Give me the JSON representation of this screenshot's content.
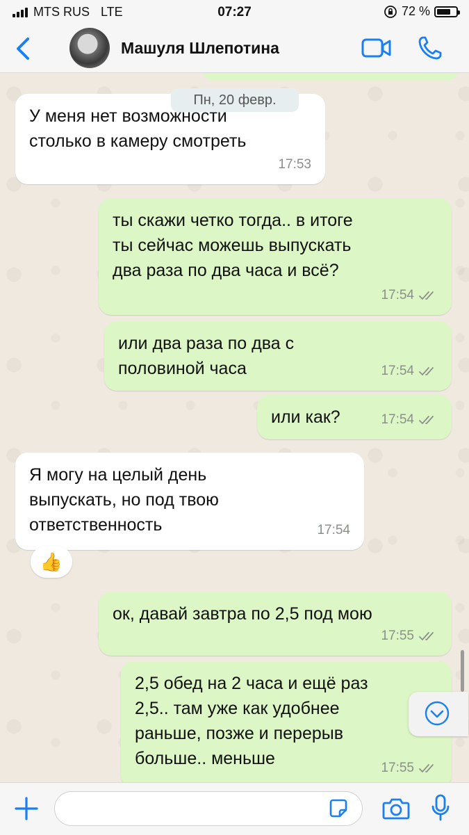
{
  "status_bar": {
    "carrier": "MTS RUS",
    "network": "LTE",
    "time": "07:27",
    "battery": "72 %",
    "battery_level": 0.72
  },
  "header": {
    "contact_name": "Машуля Шлепотина",
    "accent_color": "#1a7ff2"
  },
  "chat": {
    "date_chip": "Пн, 20 февр.",
    "messages": [
      {
        "direction": "in",
        "text": "У меня нет возможности\nстолько в камеру смотреть",
        "time": "17:53"
      },
      {
        "direction": "out",
        "text": "ты скажи четко тогда.. в итоге\nты сейчас можешь выпускать\nдва раза по два часа и всё?",
        "time": "17:54"
      },
      {
        "direction": "out",
        "text": "или два раза по два с\nполовиной часа",
        "time": "17:54"
      },
      {
        "direction": "out",
        "text": "или как?",
        "time": "17:54"
      },
      {
        "direction": "in",
        "text": "Я могу на целый день\nвыпускать, но под твою\nответственность",
        "time": "17:54"
      },
      {
        "direction": "out",
        "text": "ок, давай завтра по 2,5 под мою",
        "time": "17:55"
      },
      {
        "direction": "out",
        "text": "2,5 обед на 2 часа и ещё раз\n2,5.. там уже как удобнее\nраньше, позже и перерыв\nбольше.. меньше",
        "time": "17:55"
      }
    ],
    "reaction": "👍",
    "bubble_colors": {
      "incoming": "#ffffff",
      "outgoing": "#dcf7c5"
    }
  },
  "input": {
    "placeholder": ""
  },
  "icons": [
    "back-icon",
    "video-call-icon",
    "phone-icon",
    "plus-icon",
    "sticker-icon",
    "camera-icon",
    "microphone-icon",
    "read-ticks-icon",
    "scroll-down-icon"
  ]
}
